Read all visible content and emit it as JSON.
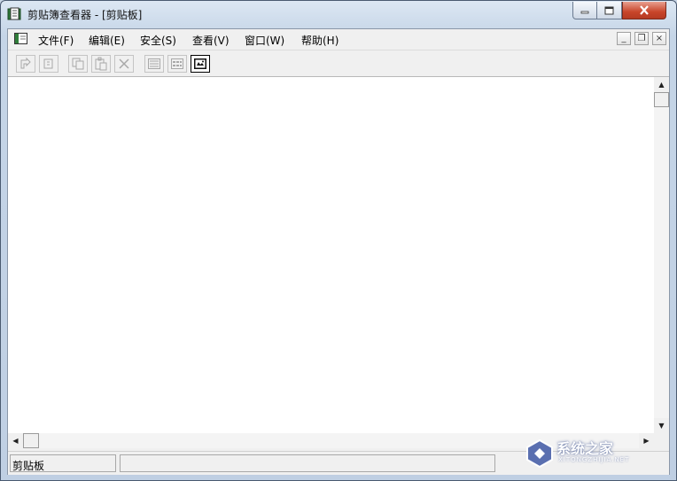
{
  "window": {
    "title": "剪贴簿查看器 - [剪贴板]"
  },
  "title_controls": {
    "minimize_icon": "minimize-icon",
    "maximize_icon": "maximize-icon",
    "close_icon": "close-icon"
  },
  "menubar": {
    "items": [
      {
        "label": "文件(F)"
      },
      {
        "label": "编辑(E)"
      },
      {
        "label": "安全(S)"
      },
      {
        "label": "查看(V)"
      },
      {
        "label": "窗口(W)"
      },
      {
        "label": "帮助(H)"
      }
    ],
    "mdi_minimize": "_",
    "mdi_restore": "❐",
    "mdi_close": "×"
  },
  "toolbar": {
    "buttons": [
      {
        "icon": "connect-icon",
        "enabled": false
      },
      {
        "icon": "disconnect-icon",
        "enabled": false
      },
      {
        "icon": "copy-icon",
        "enabled": false
      },
      {
        "icon": "paste-icon",
        "enabled": false
      },
      {
        "icon": "delete-icon",
        "enabled": false
      },
      {
        "icon": "list-view-icon",
        "enabled": false
      },
      {
        "icon": "thumbnail-view-icon",
        "enabled": false
      },
      {
        "icon": "full-page-view-icon",
        "enabled": true,
        "active": true
      }
    ]
  },
  "scrollbar": {
    "up_arrow": "▲",
    "down_arrow": "▼",
    "left_arrow": "◀",
    "right_arrow": "▶"
  },
  "statusbar": {
    "pane1": "剪贴板",
    "pane2": ""
  },
  "watermark": {
    "text": "系统之家",
    "sub": "XITONGZHIJIA.NET"
  },
  "colors": {
    "title_bar": "#c9d6e6",
    "close_button": "#c8452a",
    "client_bg": "#f0f0f0",
    "canvas_bg": "#ffffff"
  }
}
